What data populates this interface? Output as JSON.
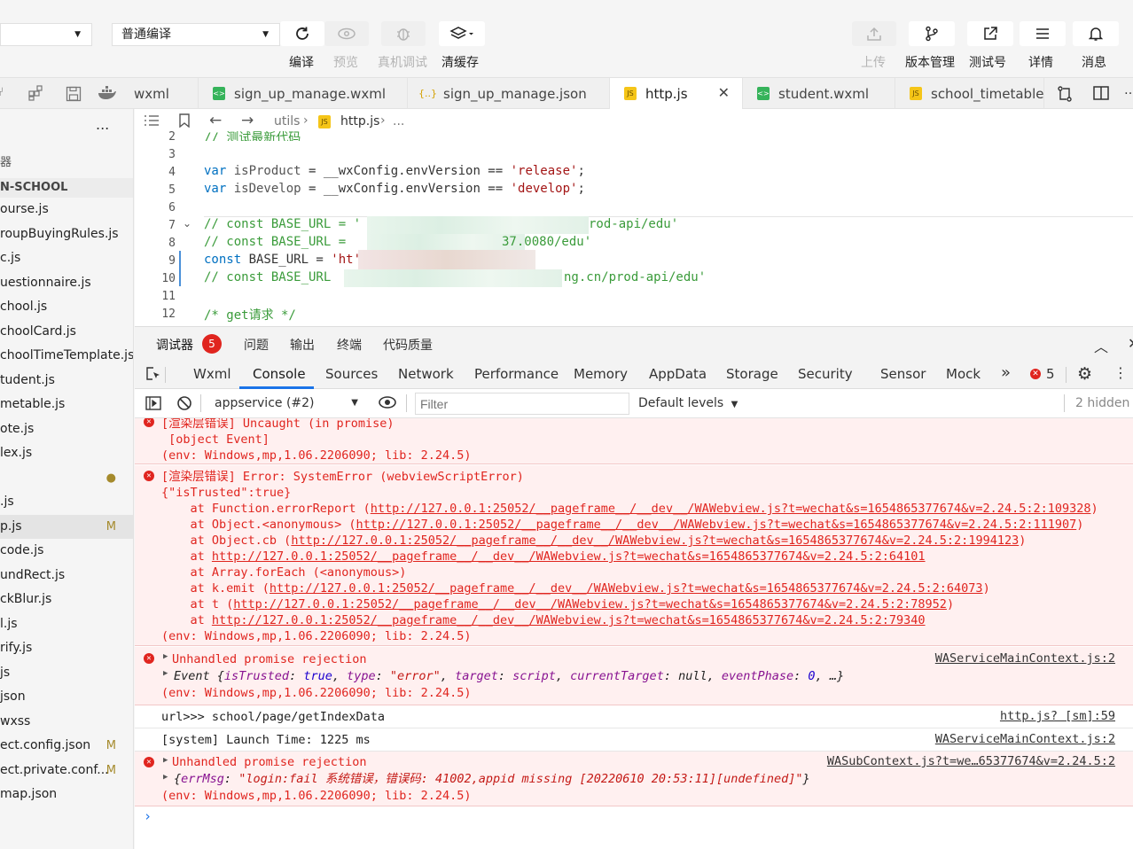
{
  "toolbar": {
    "mode_select": "",
    "compile_select": "普通编译",
    "buttons": {
      "compile": "编译",
      "preview": "预览",
      "remote_debug": "真机调试",
      "clear_cache": "清缓存",
      "upload": "上传",
      "version": "版本管理",
      "test_account": "测试号",
      "details": "详情",
      "messages": "消息"
    }
  },
  "tabs": [
    {
      "label": "wxml",
      "icon": "wxml-file-icon"
    },
    {
      "label": "sign_up_manage.wxml",
      "icon": "wxml-file-icon"
    },
    {
      "label": "sign_up_manage.json",
      "icon": "json-file-icon"
    },
    {
      "label": "http.js",
      "icon": "js-file-icon",
      "active": true
    },
    {
      "label": "student.wxml",
      "icon": "wxml-file-icon"
    },
    {
      "label": "school_timetable_",
      "icon": "js-file-icon"
    }
  ],
  "explorer": {
    "more": "...",
    "section": "器",
    "project": "N-SCHOOL",
    "files": [
      {
        "name": "ourse.js",
        "badge": ""
      },
      {
        "name": "roupBuyingRules.js",
        "badge": ""
      },
      {
        "name": "c.js",
        "badge": ""
      },
      {
        "name": "uestionnaire.js",
        "badge": ""
      },
      {
        "name": "chool.js",
        "badge": ""
      },
      {
        "name": "choolCard.js",
        "badge": ""
      },
      {
        "name": "choolTimeTemplate.js",
        "badge": ""
      },
      {
        "name": "tudent.js",
        "badge": ""
      },
      {
        "name": "metable.js",
        "badge": ""
      },
      {
        "name": "ote.js",
        "badge": ""
      },
      {
        "name": "lex.js",
        "badge": ""
      },
      {
        "name": "",
        "badge": "●"
      },
      {
        "name": ".js",
        "badge": ""
      },
      {
        "name": "p.js",
        "badge": "M",
        "selected": true
      },
      {
        "name": "code.js",
        "badge": ""
      },
      {
        "name": "undRect.js",
        "badge": ""
      },
      {
        "name": "ckBlur.js",
        "badge": ""
      },
      {
        "name": "l.js",
        "badge": ""
      },
      {
        "name": "rify.js",
        "badge": ""
      },
      {
        "name": "js",
        "badge": ""
      },
      {
        "name": "json",
        "badge": ""
      },
      {
        "name": "wxss",
        "badge": ""
      },
      {
        "name": "ect.config.json",
        "badge": "M"
      },
      {
        "name": "ect.private.conf...",
        "badge": "M"
      },
      {
        "name": "map.json",
        "badge": ""
      }
    ]
  },
  "editor": {
    "crumb_folder": "utils",
    "crumb_file": "http.js",
    "crumb_more": "...",
    "lines": [
      {
        "n": "2",
        "text": "// 测试最新代码"
      },
      {
        "n": "3",
        "text": ""
      },
      {
        "n": "4",
        "a": "var ",
        "b": "isProduct",
        "c": " = __wxConfig.envVersion == ",
        "d": "'release'",
        "e": ";"
      },
      {
        "n": "5",
        "a": "var ",
        "b": "isDevelop",
        "c": " = __wxConfig.envVersion == ",
        "d": "'develop'",
        "e": ";"
      },
      {
        "n": "6",
        "text": ""
      },
      {
        "n": "7",
        "text": "// const BASE_URL = '",
        "tail": "rod-api/edu'"
      },
      {
        "n": "8",
        "text": "// const BASE_URL = ",
        "tail": "37.0080/edu'"
      },
      {
        "n": "9",
        "a2": "const ",
        "b2": "BASE_URL = ",
        "d2": "'ht'"
      },
      {
        "n": "10",
        "text": "// const BASE_URL ",
        "tail": "ng.cn/prod-api/edu'"
      },
      {
        "n": "11",
        "text": ""
      },
      {
        "n": "12",
        "text": "/* get请求 */"
      }
    ]
  },
  "panel": {
    "tabs": [
      "调试器",
      "问题",
      "输出",
      "终端",
      "代码质量"
    ],
    "debugger_badge": "5"
  },
  "devtools": {
    "tabs": [
      "Wxml",
      "Console",
      "Sources",
      "Network",
      "Performance",
      "Memory",
      "AppData",
      "Storage",
      "Security",
      "Sensor",
      "Mock"
    ],
    "more": "»",
    "error_count": "5",
    "context": "appservice (#2)",
    "filter_placeholder": "Filter",
    "levels": "Default levels",
    "hidden": "2 hidden"
  },
  "console": {
    "m1": {
      "l1": "[渲染层错误] Uncaught (in promise)",
      "l2": " [object Event]",
      "l3": "(env: Windows,mp,1.06.2206090; lib: 2.24.5)"
    },
    "m2": {
      "l1": "[渲染层错误] Error: SystemError (webviewScriptError)",
      "l2": "{\"isTrusted\":true}",
      "stack": [
        {
          "pre": "    at Function.errorReport (",
          "url": "http://127.0.0.1:25052/__pageframe__/__dev__/WAWebview.js?t=wechat&s=1654865377674&v=2.24.5:2:109328",
          "post": ")"
        },
        {
          "pre": "    at Object.<anonymous> (",
          "url": "http://127.0.0.1:25052/__pageframe__/__dev__/WAWebview.js?t=wechat&s=1654865377674&v=2.24.5:2:111907",
          "post": ")"
        },
        {
          "pre": "    at Object.cb (",
          "url": "http://127.0.0.1:25052/__pageframe__/__dev__/WAWebview.js?t=wechat&s=1654865377674&v=2.24.5:2:1994123",
          "post": ")"
        },
        {
          "pre": "    at ",
          "url": "http://127.0.0.1:25052/__pageframe__/__dev__/WAWebview.js?t=wechat&s=1654865377674&v=2.24.5:2:64101",
          "post": ""
        },
        {
          "pre": "    at Array.forEach (<anonymous>)",
          "url": "",
          "post": ""
        },
        {
          "pre": "    at k.emit (",
          "url": "http://127.0.0.1:25052/__pageframe__/__dev__/WAWebview.js?t=wechat&s=1654865377674&v=2.24.5:2:64073",
          "post": ")"
        },
        {
          "pre": "    at t (",
          "url": "http://127.0.0.1:25052/__pageframe__/__dev__/WAWebview.js?t=wechat&s=1654865377674&v=2.24.5:2:78952",
          "post": ")"
        },
        {
          "pre": "    at ",
          "url": "http://127.0.0.1:25052/__pageframe__/__dev__/WAWebview.js?t=wechat&s=1654865377674&v=2.24.5:2:79340",
          "post": ""
        }
      ],
      "env": "(env: Windows,mp,1.06.2206090; lib: 2.24.5)"
    },
    "m3": {
      "l1": "Unhandled promise rejection",
      "src": "WAServiceMainContext.js:2",
      "event_label": "Event {",
      "k1": "isTrusted",
      "v1": "true",
      "k2": "type",
      "v2": "\"error\"",
      "k3": "target",
      "v3": "script",
      "k4": "currentTarget",
      "v4": "null",
      "k5": "eventPhase",
      "v5": "0",
      "tail": ", …}",
      "env": "(env: Windows,mp,1.06.2206090; lib: 2.24.5)"
    },
    "m4": {
      "text": "url>>> school/page/getIndexData",
      "src": "http.js? [sm]:59"
    },
    "m5": {
      "text": "[system] Launch Time: 1225 ms",
      "src": "WAServiceMainContext.js:2"
    },
    "m6": {
      "l1": "Unhandled promise rejection",
      "src": "WASubContext.js?t=we…65377674&v=2.24.5:2",
      "k1": "errMsg",
      "v1": "\"login:fail 系统错误，错误码: 41002,appid missing [20220610 20:53:11][undefined]\"",
      "env": "(env: Windows,mp,1.06.2206090; lib: 2.24.5)"
    },
    "prompt": "›"
  },
  "colors": {
    "accent": "#1a73e8",
    "error": "#e0251f",
    "error_bg": "#fff0f0",
    "comment": "#3a9b3a"
  }
}
